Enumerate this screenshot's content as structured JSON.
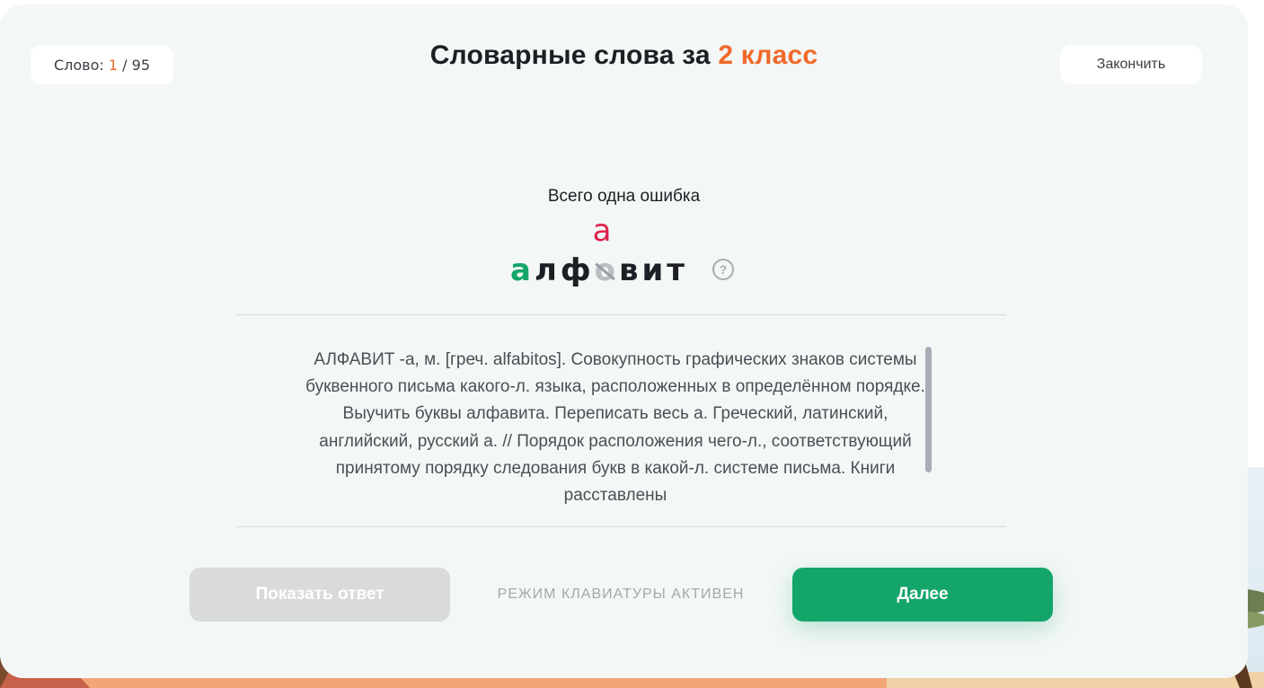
{
  "header": {
    "counter_label": "Слово:",
    "counter_current": "1",
    "counter_total": "/ 95",
    "title_main": "Словарные слова за",
    "title_accent": "2 класс",
    "finish_label": "Закончить"
  },
  "task": {
    "hint": "Всего одна ошибка",
    "word_prefix_ok": "а",
    "word_prefix": "лф",
    "word_wrong_letter": "о",
    "word_correct_letter": "а",
    "word_suffix": "вит",
    "help_icon": "?"
  },
  "definition": "АЛФАВИТ -а, м. [греч. alfabitos]. Совокупность графических знаков системы буквенного письма какого-л. языка, расположенных в определённом порядке. Выучить буквы алфавита. Переписать весь а. Греческий, латинский, английский, русский а. // Порядок расположения чего-л., соответствующий принятому порядку следования букв в какой-л. системе письма. Книги расставлены",
  "footer": {
    "show_answer_label": "Показать ответ",
    "keyboard_mode_label": "РЕЖИМ КЛАВИАТУРЫ АКТИВЕН",
    "next_label": "Далее"
  },
  "colors": {
    "accent_orange": "#f06a2a",
    "green": "#14a56b",
    "error_red": "#e0204a",
    "card_bg": "#f3f7f5"
  }
}
